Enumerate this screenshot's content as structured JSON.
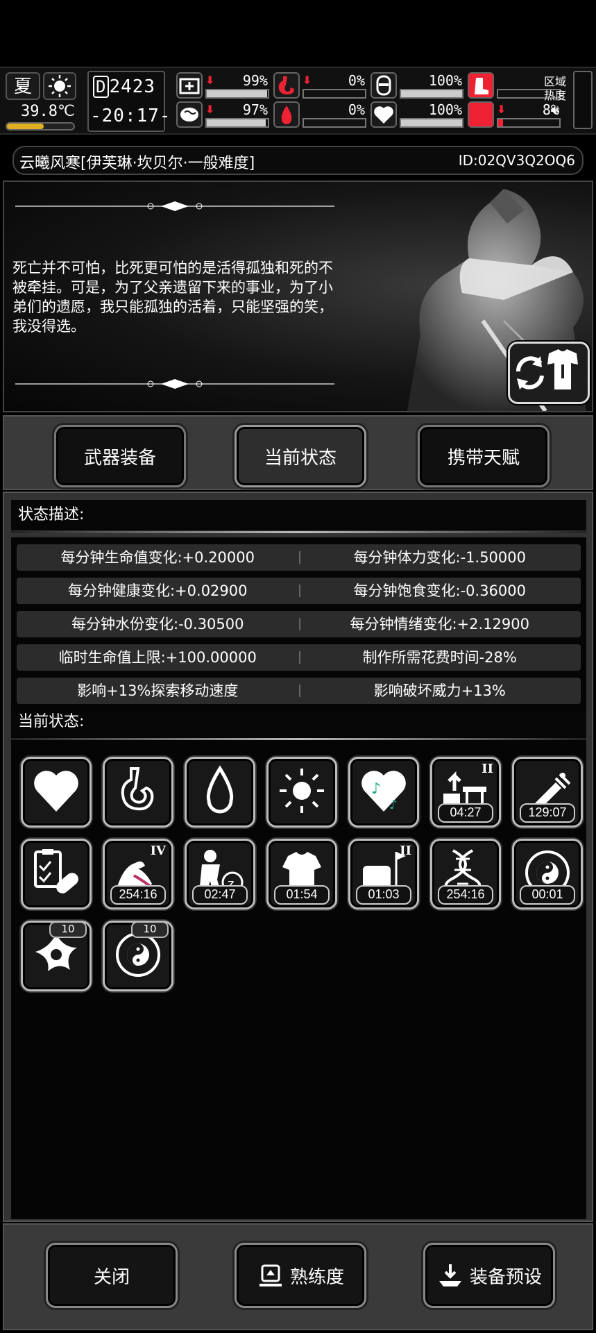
{
  "hud": {
    "season": "夏",
    "temperature": "39.8℃",
    "temperature_fill": 0.55,
    "day_counter": "2423",
    "day_prefix": "D",
    "time": "-20:17-",
    "stats": [
      {
        "icon": "medkit-icon",
        "trend": "down",
        "value": "99%",
        "fill": 0.99
      },
      {
        "icon": "stomach-icon",
        "trend": "down",
        "value": "0%",
        "fill": 0.0
      },
      {
        "icon": "stamina-icon",
        "trend": "none",
        "value": "100%",
        "fill": 1.0
      },
      {
        "icon": "boot-icon",
        "trend": "none",
        "value": "",
        "fill": 0
      },
      {
        "icon": "brain-icon",
        "trend": "down",
        "value": "97%",
        "fill": 0.97
      },
      {
        "icon": "water-drop-icon",
        "trend": "none",
        "value": "0%",
        "fill": 0.0
      },
      {
        "icon": "heart-icon",
        "trend": "none",
        "value": "100%",
        "fill": 1.0
      },
      {
        "icon": "injury-icon",
        "trend": "down",
        "value": "8%",
        "fill": 0.08
      }
    ],
    "zone_label_1": "区域",
    "zone_label_2": "热度",
    "sound_icon": "speaker-icon"
  },
  "title": {
    "name": "云曦风寒[伊芙琳·坎贝尔·一般难度]",
    "id": "ID:02QV3Q2OQ6"
  },
  "portrait": {
    "quote": "死亡并不可怕，比死更可怕的是活得孤独和死的不被牵挂。可是，为了父亲遗留下来的事业，为了小弟们的遗愿，我只能孤独的活着，只能坚强的笑，我没得选。",
    "outfit_icon": "outfit-swap-icon"
  },
  "tabs": [
    {
      "label": "武器装备",
      "active": false
    },
    {
      "label": "当前状态",
      "active": true
    },
    {
      "label": "携带天赋",
      "active": false
    }
  ],
  "status_description": {
    "heading": "状态描述:",
    "rows": [
      [
        "每分钟生命值变化:+0.20000",
        "每分钟体力变化:-1.50000"
      ],
      [
        "每分钟健康变化:+0.02900",
        "每分钟饱食变化:-0.36000"
      ],
      [
        "每分钟水份变化:-0.30500",
        "每分钟情绪变化:+2.12900"
      ],
      [
        "临时生命值上限:+100.00000",
        "制作所需花费时间-28%"
      ],
      [
        "影响+13%探索移动速度",
        "影响破坏威力+13%"
      ]
    ]
  },
  "current_status": {
    "heading": "当前状态:",
    "buffs": [
      {
        "icon": "heart-icon",
        "timer": "",
        "stack": "",
        "level": ""
      },
      {
        "icon": "stomach-icon",
        "timer": "",
        "stack": "",
        "level": ""
      },
      {
        "icon": "water-drop-icon",
        "timer": "",
        "stack": "",
        "level": ""
      },
      {
        "icon": "sun-icon",
        "timer": "",
        "stack": "",
        "level": ""
      },
      {
        "icon": "music-heart-icon",
        "timer": "",
        "stack": "",
        "level": ""
      },
      {
        "icon": "upgrade-bench-icon",
        "timer": "04:27",
        "stack": "",
        "level": "II"
      },
      {
        "icon": "syringe-icon",
        "timer": "129:07",
        "stack": "",
        "level": ""
      },
      {
        "icon": "medicine-clipboard-icon",
        "timer": "",
        "stack": "",
        "level": ""
      },
      {
        "icon": "muscle-arm-icon",
        "timer": "254:16",
        "stack": "",
        "level": "IV"
      },
      {
        "icon": "rest-icon",
        "timer": "02:47",
        "stack": "",
        "level": ""
      },
      {
        "icon": "shirt-icon",
        "timer": "01:54",
        "stack": "",
        "level": ""
      },
      {
        "icon": "fist-flag-icon",
        "timer": "01:03",
        "stack": "",
        "level": "II"
      },
      {
        "icon": "dna-icon",
        "timer": "254:16",
        "stack": "",
        "level": ""
      },
      {
        "icon": "yin-yang-swirl-icon",
        "timer": "00:01",
        "stack": "",
        "level": ""
      },
      {
        "icon": "shuriken-swirl-icon",
        "timer": "",
        "stack": "10",
        "level": ""
      },
      {
        "icon": "yin-yang-swirl-icon",
        "timer": "",
        "stack": "10",
        "level": ""
      }
    ]
  },
  "bottom": {
    "close_label": "关闭",
    "proficiency_label": "熟练度",
    "preset_label": "装备预设"
  }
}
